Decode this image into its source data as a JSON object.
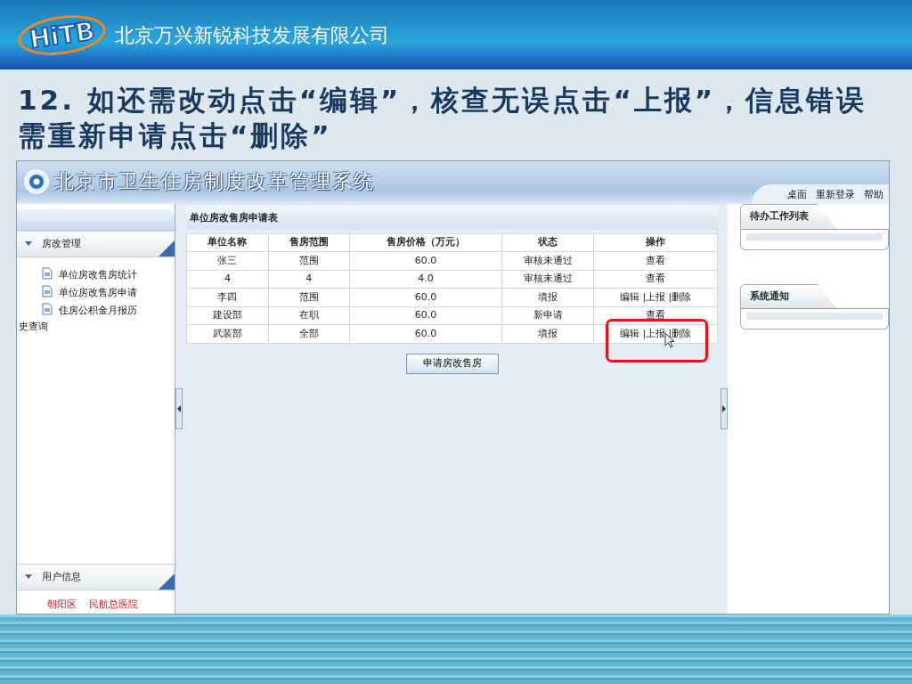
{
  "slide": {
    "logo": "HiTB",
    "company": "北京万兴新锐科技发展有限公司",
    "heading": "12. 如还需改动点击“编辑”，核查无误点击“上报”，信息错误需重新申请点击“删除”"
  },
  "app": {
    "title": "北京市卫生住房制度改革管理系统",
    "top_links": [
      "桌面",
      "重新登录",
      "帮助"
    ],
    "sidebar": {
      "sections": [
        {
          "label": "房改管理",
          "expanded": true,
          "items": [
            "单位房改售房统计",
            "单位房改售房申请",
            "住房公积金月报历史查询"
          ]
        },
        {
          "label": "用户信息",
          "expanded": true
        }
      ],
      "user_info": [
        "朝阳区",
        "民航总医院"
      ]
    },
    "table": {
      "title": "单位房改售房申请表",
      "columns": [
        "单位名称",
        "售房范围",
        "售房价格（万元）",
        "状态",
        "操作"
      ],
      "separator": "|",
      "rows": [
        {
          "cells": [
            "张三",
            "范围",
            "60.0",
            "审核未通过"
          ],
          "actions": [
            "查看"
          ],
          "highlighted": false
        },
        {
          "cells": [
            "4",
            "4",
            "4.0",
            "审核未通过"
          ],
          "actions": [
            "查看"
          ],
          "highlighted": false
        },
        {
          "cells": [
            "李四",
            "范围",
            "60.0",
            "填报"
          ],
          "actions": [
            "编辑",
            "上报",
            "删除"
          ],
          "highlighted": false
        },
        {
          "cells": [
            "建设部",
            "在职",
            "60.0",
            "新申请"
          ],
          "actions": [
            "查看"
          ],
          "highlighted": false
        },
        {
          "cells": [
            "武装部",
            "全部",
            "60.0",
            "填报"
          ],
          "actions": [
            "编辑",
            "上报",
            "删除"
          ],
          "highlighted": true
        }
      ]
    },
    "button": "申请房改售房",
    "right_panels": [
      "待办工作列表",
      "系统通知"
    ]
  }
}
